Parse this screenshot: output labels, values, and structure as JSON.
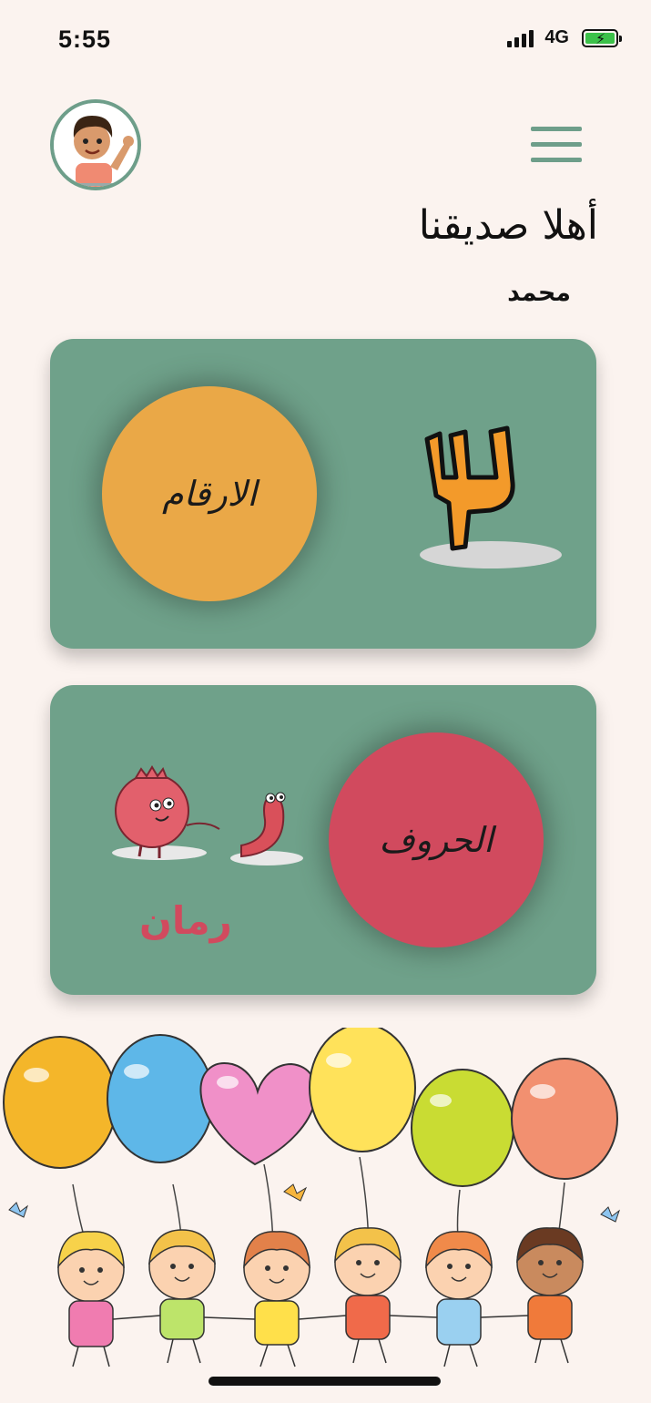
{
  "status_bar": {
    "time": "5:55",
    "network": "4G",
    "signal_bars": 4,
    "battery_charging": true
  },
  "header": {
    "greeting": "أهلا صديقنا",
    "username": "محمد",
    "avatar_icon": "boy-waving-avatar-icon",
    "menu_icon": "hamburger-menu-icon"
  },
  "cards": {
    "numbers": {
      "label": "الارقام",
      "digit": "٣",
      "circle_color": "#eaa847"
    },
    "letters": {
      "label": "الحروف",
      "word": "رمان",
      "illustration_icon": "pomegranate-and-worm-icon",
      "circle_color": "#d14a5e"
    }
  },
  "footer": {
    "illustration_icon": "balloons-and-children-icon"
  },
  "colors": {
    "background": "#fbf3ef",
    "card": "#6fa18a",
    "accent_green": "#6e9e8a"
  }
}
